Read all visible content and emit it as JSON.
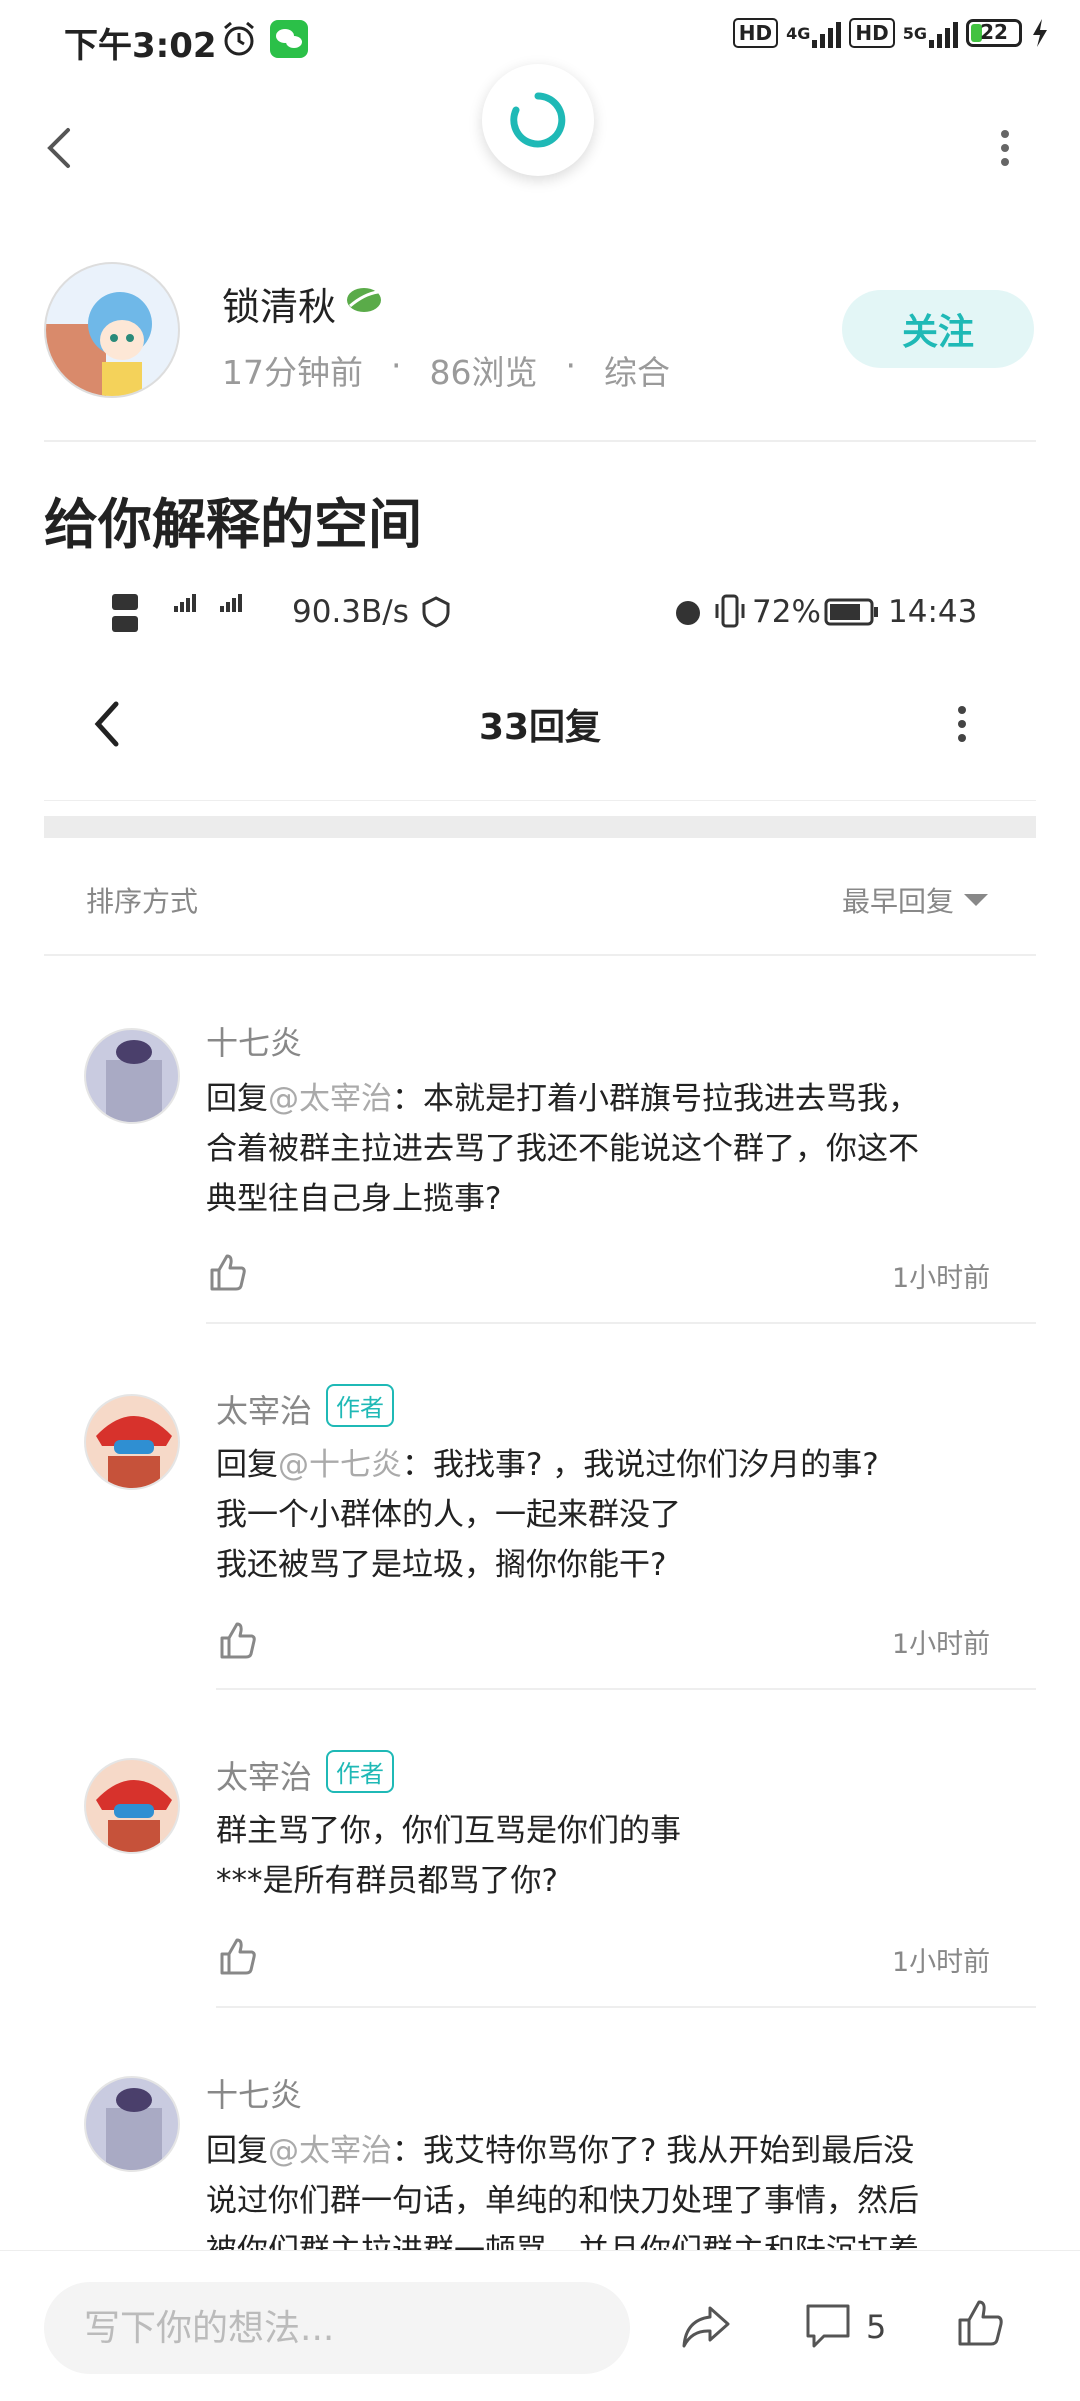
{
  "status_bar": {
    "time": "下午3:02",
    "network_a": "4G",
    "network_b": "5G",
    "battery": "22"
  },
  "nav": {
    "back": "back",
    "more": "more"
  },
  "author": {
    "name": "锁清秋",
    "time_ago": "17分钟前",
    "sep": "·",
    "views": "86浏览",
    "category": "综合",
    "follow_label": "关注"
  },
  "post": {
    "title": "给你解释的空间"
  },
  "embed": {
    "status": {
      "speed": "90.3B/s",
      "battery": "72%",
      "time": "14:43"
    },
    "title": "33回复",
    "sort_label": "排序方式",
    "sort_value": "最早回复",
    "author_tag": "作者",
    "comments": [
      {
        "name": "十七炎",
        "reply_prefix": "回复",
        "mention": "@太宰治",
        "lines": [
          "：本就是打着小群旗号拉我进去骂我，",
          "合着被群主拉进去骂了我还不能说这个群了，你这不",
          "典型往自己身上揽事?"
        ],
        "time": "1小时前"
      },
      {
        "name": "太宰治",
        "reply_prefix": "回复",
        "mention": "@十七炎",
        "lines": [
          "：我找事? ，我说过你们汐月的事?",
          "我一个小群体的人，一起来群没了",
          "我还被骂了是垃圾，搁你你能干?"
        ],
        "time": "1小时前"
      },
      {
        "name": "太宰治",
        "lines": [
          "群主骂了你，你们互骂是你们的事",
          "***是所有群员都骂了你?"
        ],
        "time": "1小时前"
      },
      {
        "name": "十七炎",
        "reply_prefix": "回复",
        "mention": "@太宰治",
        "lines": [
          "：我艾特你骂你了? 我从开始到最后没",
          "说过你们群一句话，单纯的和快刀处理了事情，然后",
          "被你们群主拉进群一顿骂，并且你们群主和陆沉打着"
        ]
      }
    ]
  },
  "bottom": {
    "placeholder": "写下你的想法...",
    "comment_count": "5"
  },
  "colors": {
    "accent": "#1fb9b6",
    "follow_bg": "#e3f6f6"
  }
}
